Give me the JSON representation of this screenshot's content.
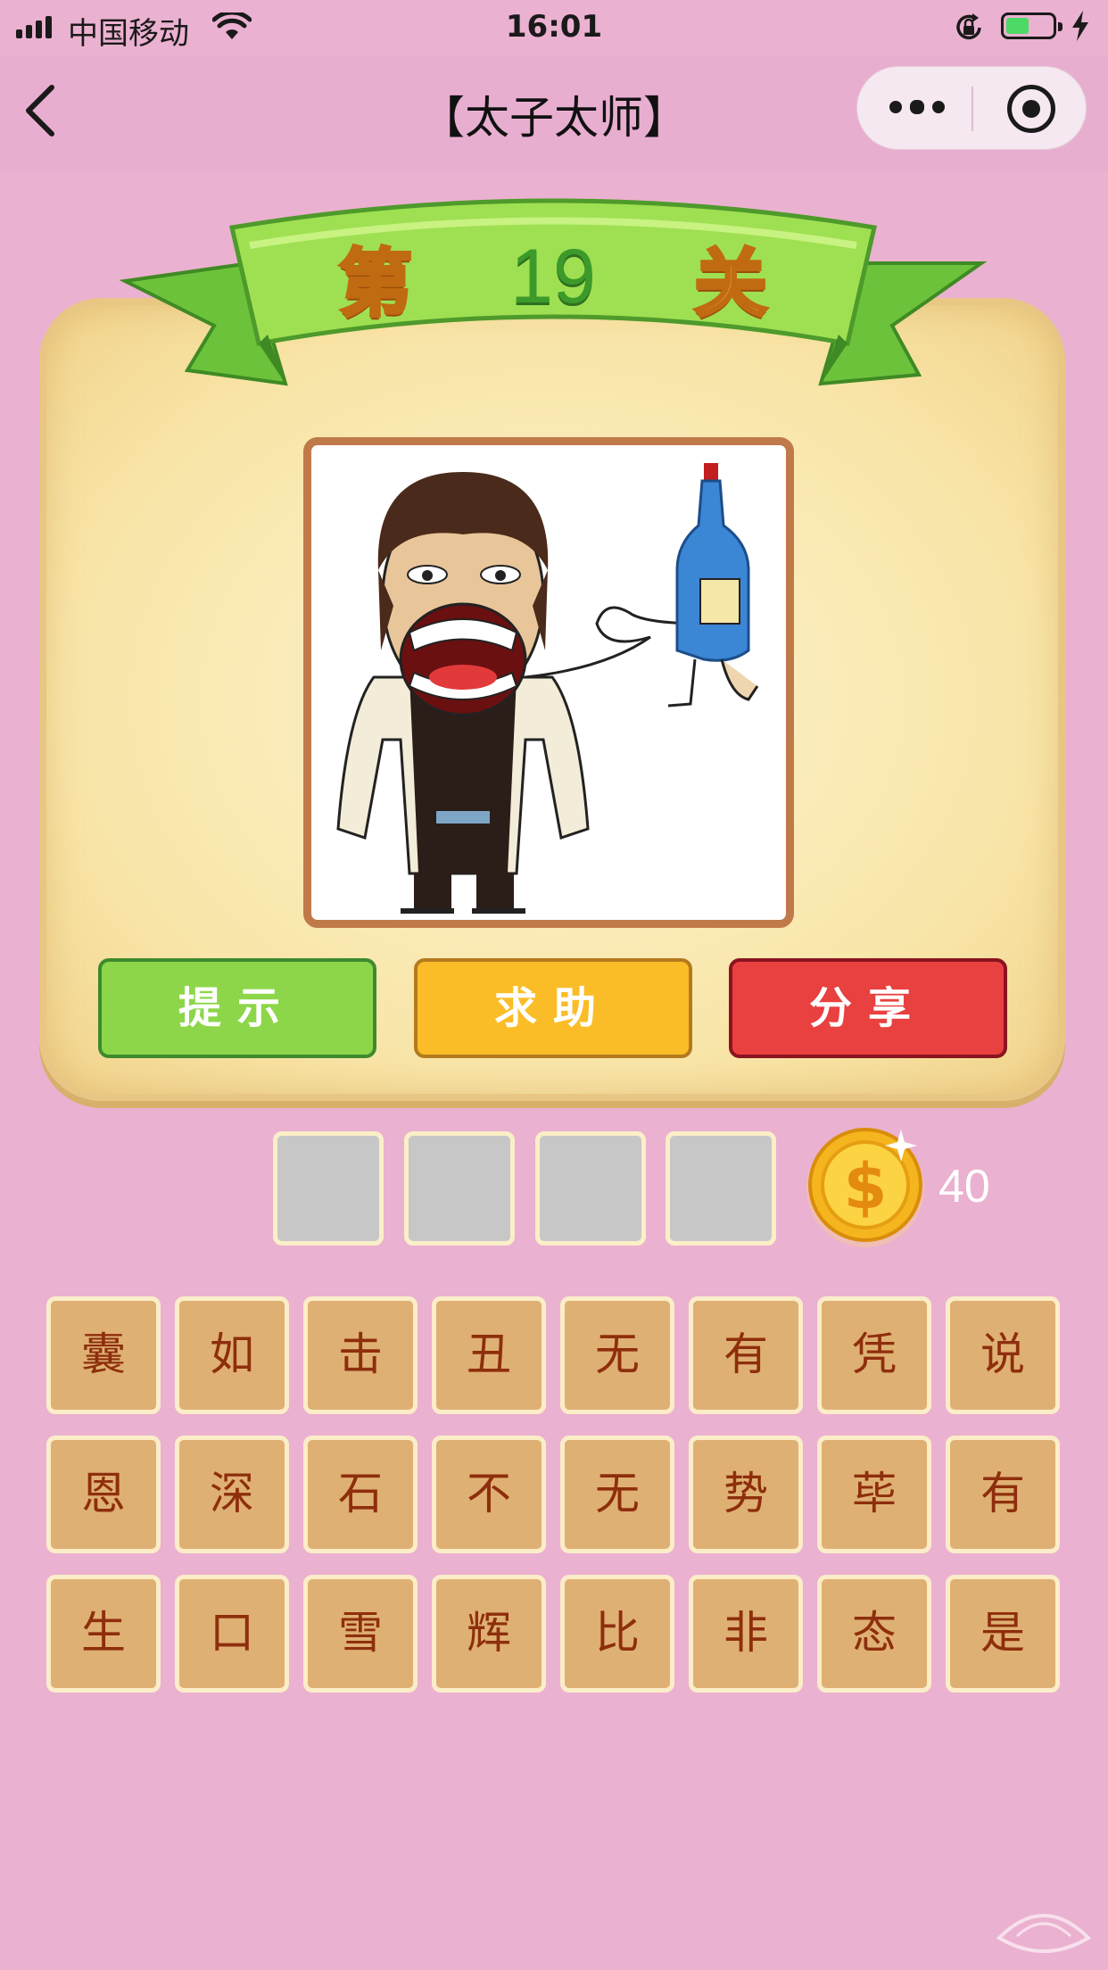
{
  "status_bar": {
    "carrier": "中国移动",
    "time": "16:01",
    "battery_level": 0.44,
    "icons": [
      "signal-icon",
      "wifi-icon",
      "rotation-lock-icon",
      "battery-icon",
      "charging-icon"
    ]
  },
  "nav": {
    "title": "【太子太师】",
    "back_icon": "chevron-left-icon",
    "more_icon": "more-dots-icon",
    "close_icon": "target-close-icon"
  },
  "level": {
    "prefix": "第",
    "number": "19",
    "suffix": "关"
  },
  "buttons": {
    "hint": "提示",
    "help": "求助",
    "share": "分享"
  },
  "answer_slots": [
    "",
    "",
    "",
    ""
  ],
  "coins": "40",
  "colors": {
    "background": "#ebb1d0",
    "hint": "#8dd64a",
    "help": "#fbbd27",
    "share": "#e94040",
    "tile": "#dfb073",
    "tile_text": "#8e2e0c"
  },
  "tiles": [
    "囊",
    "如",
    "击",
    "丑",
    "无",
    "有",
    "凭",
    "说",
    "恩",
    "深",
    "石",
    "不",
    "无",
    "势",
    "荜",
    "有",
    "生",
    "口",
    "雪",
    "辉",
    "比",
    "非",
    "态",
    "是"
  ]
}
